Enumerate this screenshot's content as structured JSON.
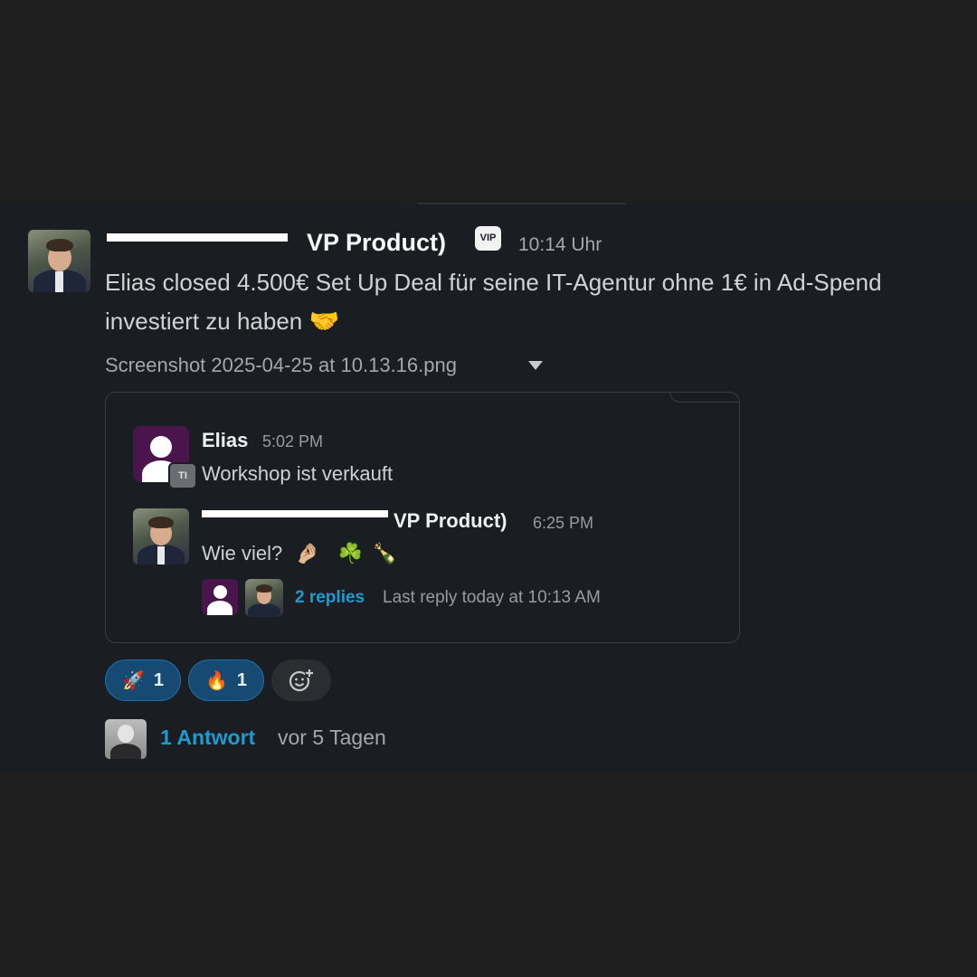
{
  "message": {
    "sender_visible": "VP Product)",
    "sender_inner_visible": "VP Product)",
    "vip_badge": "VIP",
    "time": "10:14 Uhr",
    "text_line1": "Elias closed 4.500€ Set Up Deal für seine IT-Agentur ohne 1€ in Ad-Spend",
    "text_line2": "investiert zu haben",
    "text_emoji": "🤝",
    "file_name": "Screenshot 2025-04-25 at 10.13.16.png"
  },
  "attachment": {
    "msg1": {
      "name": "Elias",
      "time": "5:02 PM",
      "text": "Workshop ist verkauft",
      "badge": "TI"
    },
    "msg2": {
      "name_visible": "VP Product)",
      "time": "6:25 PM",
      "text": "Wie viel?",
      "emojis": [
        "🤌🏼",
        "☘️",
        "🍾"
      ],
      "replies_label": "2 replies",
      "last_reply": "Last reply today at 10:13 AM"
    }
  },
  "reactions": [
    {
      "emoji": "🚀",
      "count": "1"
    },
    {
      "emoji": "🔥",
      "count": "1"
    }
  ],
  "add_reaction_icon": "add-emoji-icon",
  "thread": {
    "reply_count": "1 Antwort",
    "age": "vor 5 Tagen"
  },
  "colors": {
    "panel": "#1a1d21",
    "link": "#1d9bd1",
    "reaction_bg": "#174a73"
  }
}
